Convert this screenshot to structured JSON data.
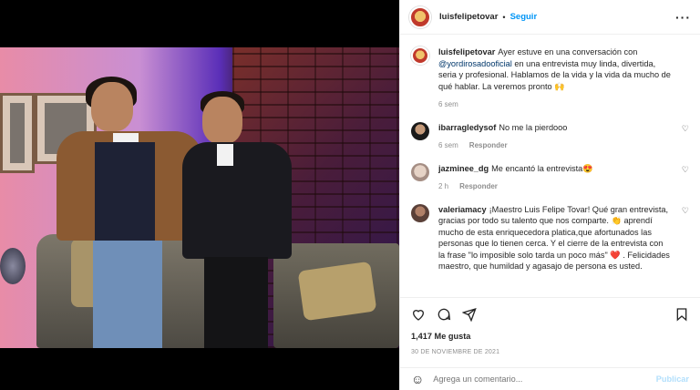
{
  "post": {
    "username": "luisfelipetovar",
    "follow_label": "Seguir",
    "more_icon": "more-options-icon",
    "caption_parts": {
      "before": "Ayer estuve en una conversación con ",
      "mention": "@yordirosadooficial",
      "after": " en una entrevista muy linda, divertida, seria y profesional. Hablamos de la vida y la vida da mucho de qué hablar. La veremos pronto 🙌"
    },
    "caption_time": "6 sem",
    "likes": "1,417 Me gusta",
    "date": "30 DE NOVIEMBRE DE 2021"
  },
  "comments": [
    {
      "user": "ibarragledysof",
      "text": "No me la pierdooo",
      "time": "6 sem",
      "reply": "Responder"
    },
    {
      "user": "jazminee_dg",
      "text": "Me encantó la entrevista😍",
      "time": "2 h",
      "reply": "Responder"
    },
    {
      "user": "valeriamacy",
      "text": "¡Maestro Luis Felipe Tovar! Qué gran entrevista, gracias por todo su talento que nos comparte. 👏 aprendí mucho de esta enriquecedora platica,que afortunados las personas que lo tienen cerca. Y el cierre de la entrevista con la frase \"lo imposible solo tarda un poco más\" ❤️ . Felicidades maestro, que humildad y agasajo de persona es usted.",
      "time": "",
      "reply": ""
    }
  ],
  "add_comment": {
    "placeholder": "Agrega un comentario...",
    "publish_label": "Publicar"
  },
  "colors": {
    "accent": "#0095f6",
    "publish_disabled": "#b2dffc",
    "muted": "#8e8e8e"
  }
}
